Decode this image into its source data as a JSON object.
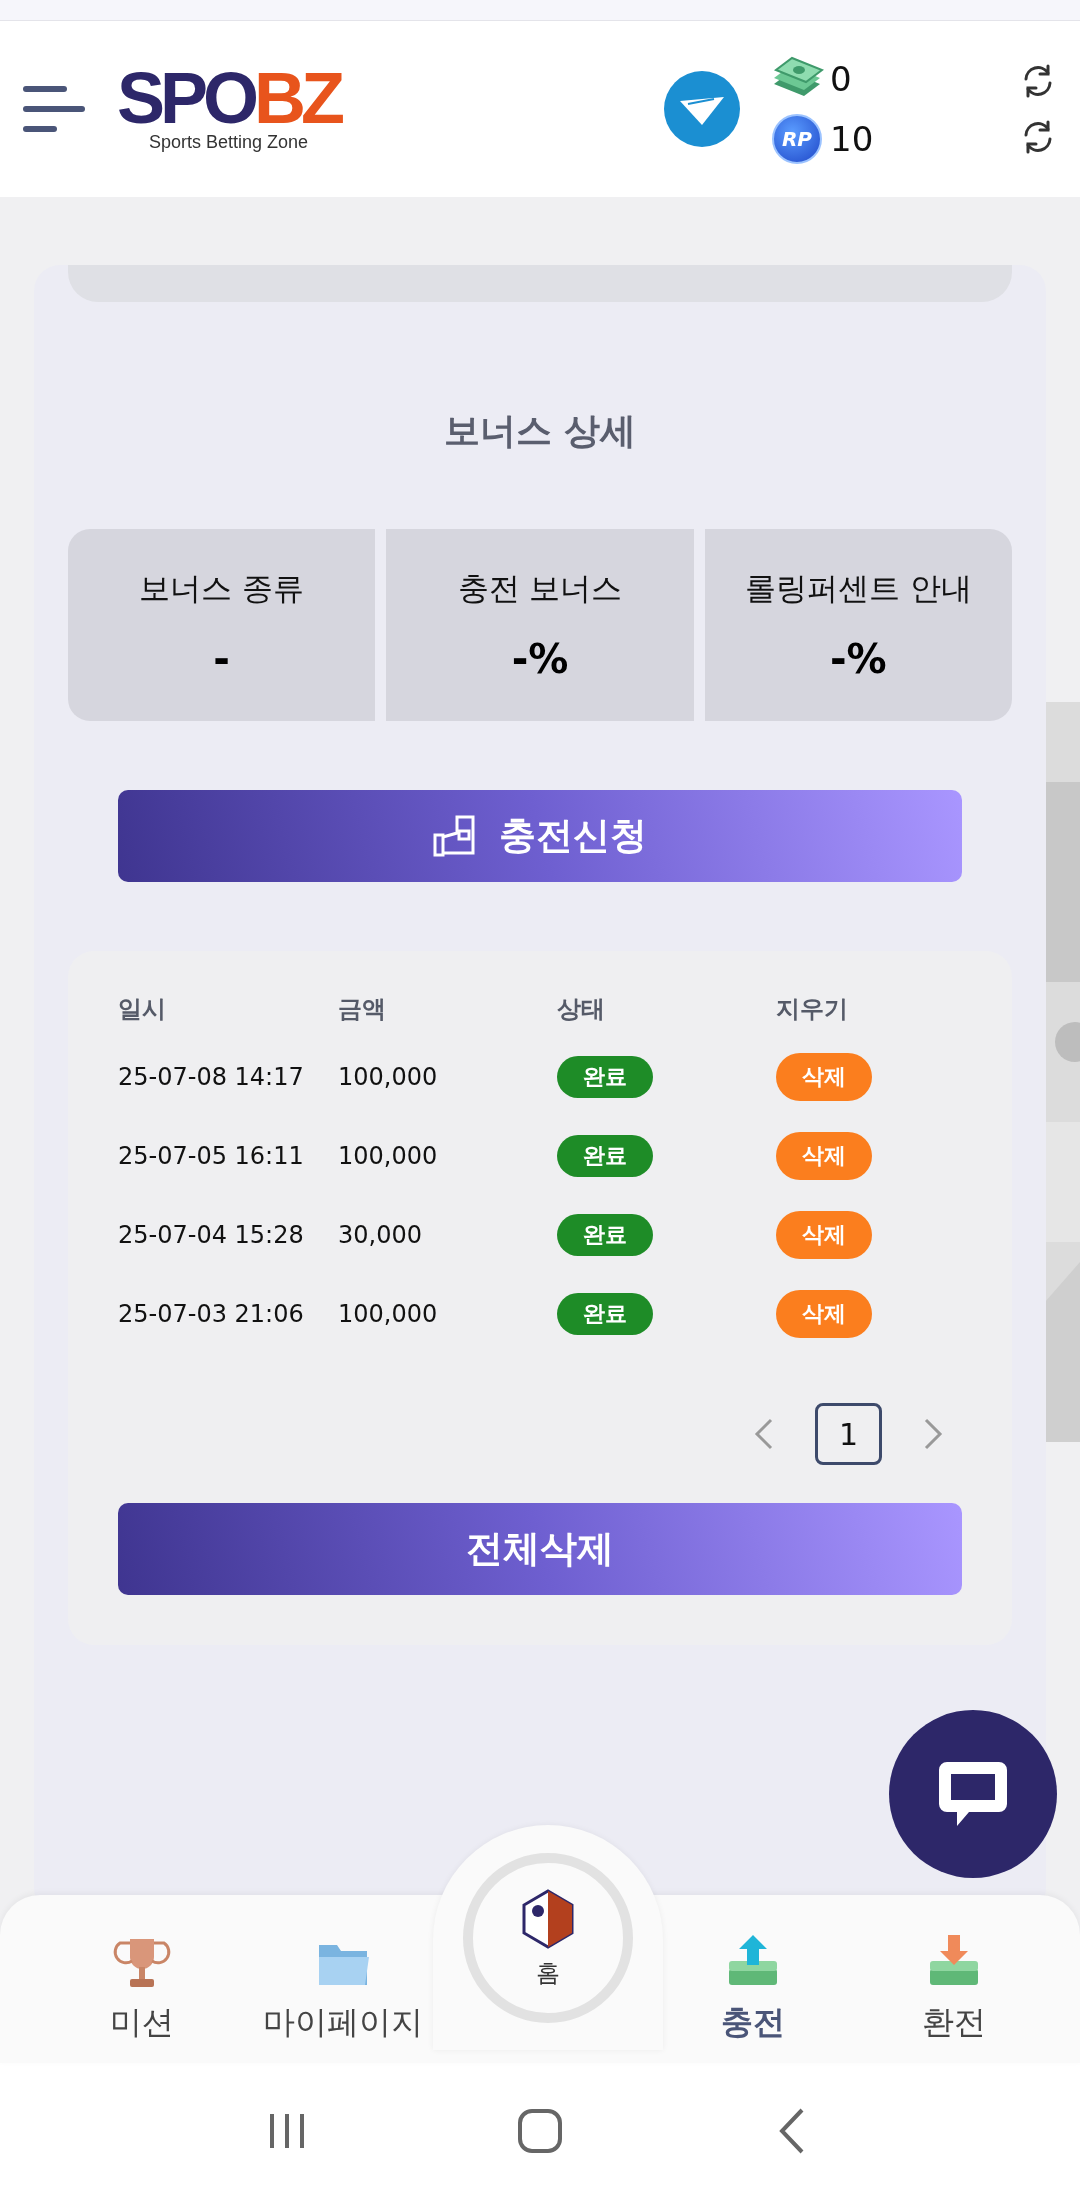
{
  "header": {
    "logo": {
      "primary": "SPO",
      "accent": "BZ",
      "tagline": "Sports Betting Zone"
    },
    "balances": [
      {
        "kind": "cash",
        "amount": "0"
      },
      {
        "kind": "rp",
        "badge": "RP",
        "amount": "10"
      }
    ]
  },
  "bonus": {
    "title": "보너스 상세",
    "items": [
      {
        "label": "보너스 종류",
        "value": "-"
      },
      {
        "label": "충전 보너스",
        "value": "-%"
      },
      {
        "label": "롤링퍼센트 안내",
        "value": "-%"
      }
    ]
  },
  "charge_button": "충전신청",
  "history": {
    "columns": [
      "일시",
      "금액",
      "상태",
      "지우기"
    ],
    "rows": [
      {
        "date": "25-07-08 14:17",
        "amount": "100,000",
        "status": "완료",
        "action": "삭제"
      },
      {
        "date": "25-07-05 16:11",
        "amount": "100,000",
        "status": "완료",
        "action": "삭제"
      },
      {
        "date": "25-07-04 15:28",
        "amount": "30,000",
        "status": "완료",
        "action": "삭제"
      },
      {
        "date": "25-07-03 21:06",
        "amount": "100,000",
        "status": "완료",
        "action": "삭제"
      }
    ],
    "pages": [
      {
        "label": "1",
        "selected": true
      }
    ],
    "delete_all": "전체삭제"
  },
  "bottom_nav": [
    {
      "kind": "trophy",
      "label": "미션",
      "selected": false
    },
    {
      "kind": "folder",
      "label": "마이페이지",
      "selected": false
    },
    {
      "kind": "home",
      "label": "홈",
      "selected": false
    },
    {
      "kind": "deposit",
      "label": "충전",
      "selected": true
    },
    {
      "kind": "withdraw",
      "label": "환전",
      "selected": false
    }
  ]
}
